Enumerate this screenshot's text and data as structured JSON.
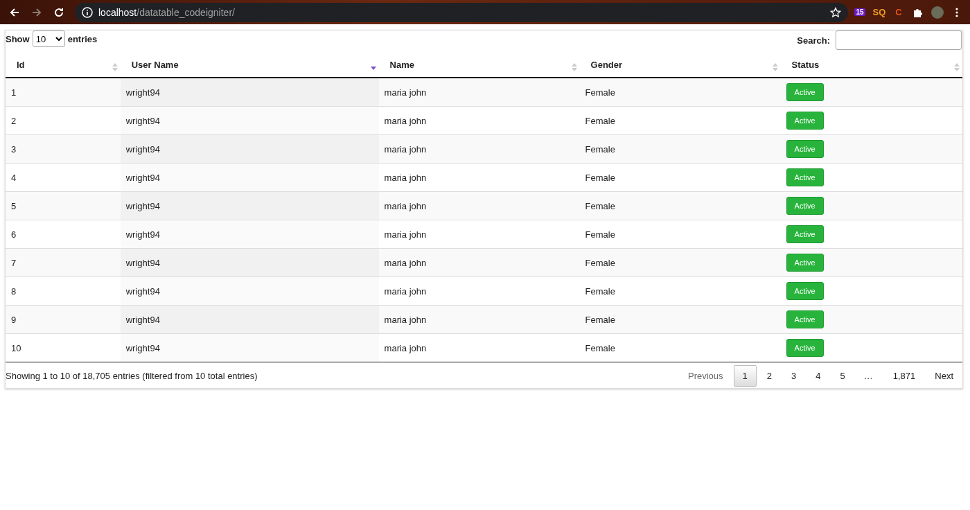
{
  "browser": {
    "url_host": "localhost",
    "url_path": "/datatable_codeigniter/",
    "back_disabled": false,
    "forward_disabled": true,
    "extensions": [
      {
        "kind": "badge",
        "label": "15"
      },
      {
        "kind": "text",
        "label": "SQ",
        "color": "#f0a020"
      },
      {
        "kind": "text",
        "label": "C",
        "color": "#e8541c"
      },
      {
        "kind": "puzzle"
      },
      {
        "kind": "avatar"
      },
      {
        "kind": "menu"
      }
    ]
  },
  "length_control": {
    "before": "Show",
    "value": "10",
    "after": "entries"
  },
  "search": {
    "label": "Search:"
  },
  "table": {
    "columns": [
      {
        "label": "Id",
        "sorted": false
      },
      {
        "label": "User Name",
        "sorted": true
      },
      {
        "label": "Name",
        "sorted": false
      },
      {
        "label": "Gender",
        "sorted": false
      },
      {
        "label": "Status",
        "sorted": false
      }
    ],
    "rows": [
      {
        "id": "1",
        "username": "wright94",
        "name": "maria john",
        "gender": "Female",
        "status": "Active"
      },
      {
        "id": "2",
        "username": "wright94",
        "name": "maria john",
        "gender": "Female",
        "status": "Active"
      },
      {
        "id": "3",
        "username": "wright94",
        "name": "maria john",
        "gender": "Female",
        "status": "Active"
      },
      {
        "id": "4",
        "username": "wright94",
        "name": "maria john",
        "gender": "Female",
        "status": "Active"
      },
      {
        "id": "5",
        "username": "wright94",
        "name": "maria john",
        "gender": "Female",
        "status": "Active"
      },
      {
        "id": "6",
        "username": "wright94",
        "name": "maria john",
        "gender": "Female",
        "status": "Active"
      },
      {
        "id": "7",
        "username": "wright94",
        "name": "maria john",
        "gender": "Female",
        "status": "Active"
      },
      {
        "id": "8",
        "username": "wright94",
        "name": "maria john",
        "gender": "Female",
        "status": "Active"
      },
      {
        "id": "9",
        "username": "wright94",
        "name": "maria john",
        "gender": "Female",
        "status": "Active"
      },
      {
        "id": "10",
        "username": "wright94",
        "name": "maria john",
        "gender": "Female",
        "status": "Active"
      }
    ]
  },
  "info": "Showing 1 to 10 of 18,705 entries (filtered from 10 total entries)",
  "pagination": [
    {
      "kind": "nav",
      "label": "Previous",
      "disabled": true
    },
    {
      "kind": "page",
      "label": "1",
      "selected": true
    },
    {
      "kind": "page",
      "label": "2",
      "selected": false
    },
    {
      "kind": "page",
      "label": "3",
      "selected": false
    },
    {
      "kind": "page",
      "label": "4",
      "selected": false
    },
    {
      "kind": "page",
      "label": "5",
      "selected": false
    },
    {
      "kind": "ellipsis",
      "label": "…"
    },
    {
      "kind": "page",
      "label": "1,871",
      "selected": false
    },
    {
      "kind": "nav",
      "label": "Next",
      "disabled": false
    }
  ]
}
